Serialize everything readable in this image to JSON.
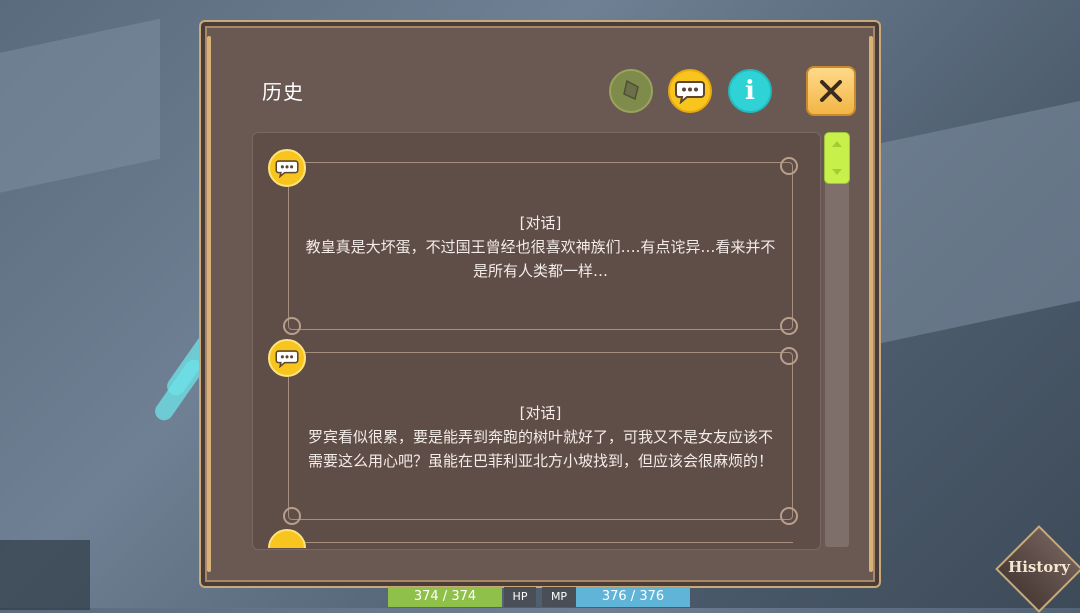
{
  "window": {
    "title": "历史"
  },
  "filters": {
    "info_glyph": "i"
  },
  "entries": [
    {
      "tag": "[对话]",
      "line1": "教皇真是大坏蛋，不过国王曾经也很喜欢神族们….有点诧异…看来并不",
      "line2": "是所有人类都一样…"
    },
    {
      "tag": "[对话]",
      "line1": "罗宾看似很累，要是能弄到奔跑的树叶就好了，可我又不是女友应该不",
      "line2": "需要这么用心吧？虽能在巴菲利亚北方小坡找到，但应该会很麻烦的！"
    }
  ],
  "hud": {
    "hp_value": "374 / 374",
    "hp_label": "HP",
    "mp_label": "MP",
    "mp_value": "376 / 376"
  },
  "history_button": {
    "label": "History"
  },
  "colors": {
    "accent_gold": "#c9a978",
    "talk_yellow": "#f7c51d",
    "info_cyan": "#2fd3d6",
    "scroll_green": "#c8f04a"
  },
  "icons": [
    "erase-icon",
    "speech-bubble-icon",
    "info-icon",
    "close-icon"
  ]
}
